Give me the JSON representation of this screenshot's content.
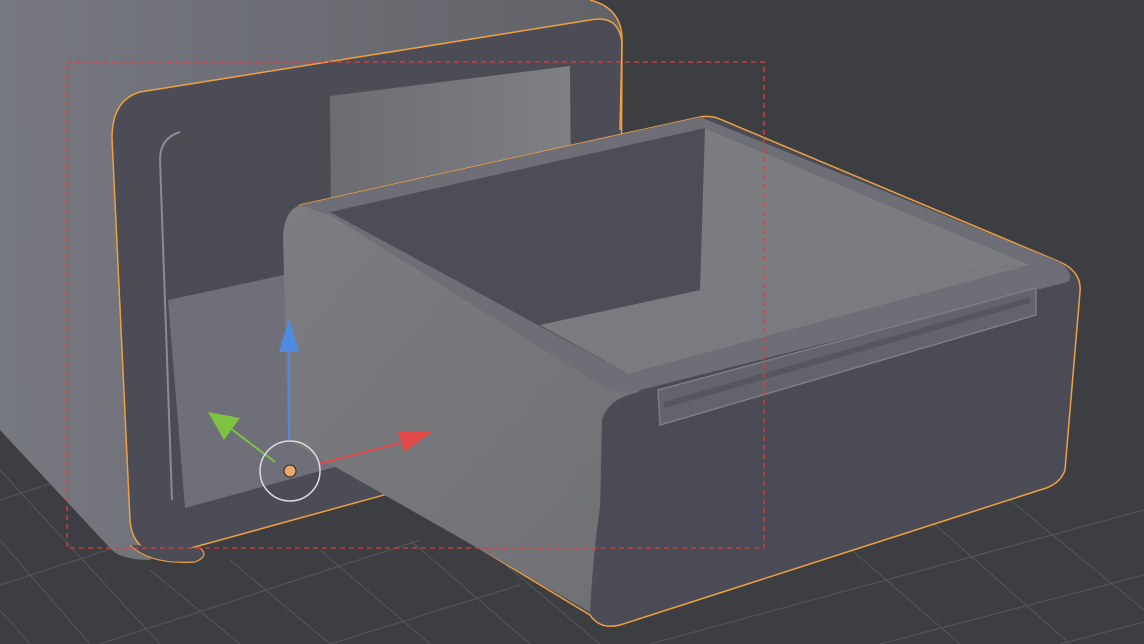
{
  "viewport": {
    "name": "3D Viewport",
    "background_color": "#3d3e42",
    "grid_color": "#54565a"
  },
  "scene": {
    "objects": [
      {
        "name": "cabinet-shell",
        "selected": true,
        "outline_color": "#f0a040",
        "surface_color": "#6b6c72"
      },
      {
        "name": "drawer",
        "selected": true,
        "outline_color": "#f0a040",
        "surface_color": "#75767b"
      }
    ],
    "border_select_box": {
      "color": "#e23c3c",
      "style": "dashed"
    }
  },
  "gizmo": {
    "type": "translate",
    "x_axis_color": "#e24a4a",
    "y_axis_color": "#7fc241",
    "z_axis_color": "#4f8ce0",
    "pivot_color": "#e8a86a",
    "ring_color": "#dcdcdc",
    "icons": {
      "x": "arrow-right-icon",
      "y": "arrow-up-left-icon",
      "z": "arrow-up-icon",
      "center": "pivot-point-icon"
    }
  }
}
